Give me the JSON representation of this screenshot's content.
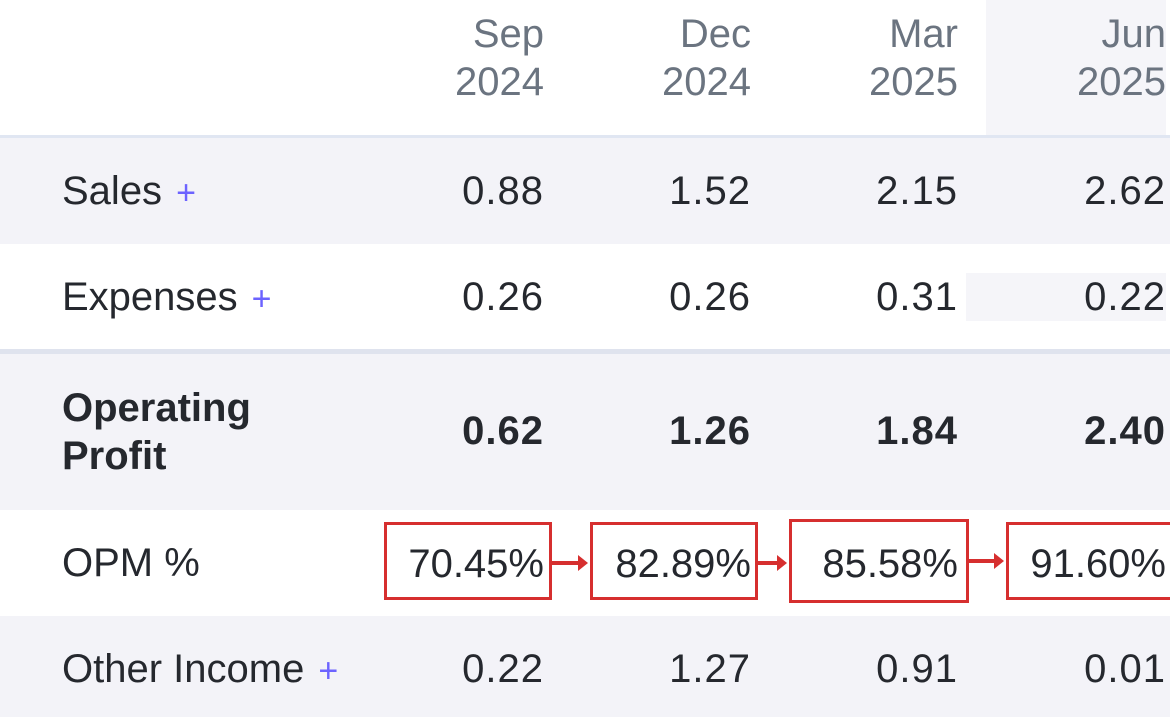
{
  "periods": [
    {
      "month": "Sep",
      "year": "2024"
    },
    {
      "month": "Dec",
      "year": "2024"
    },
    {
      "month": "Mar",
      "year": "2025"
    },
    {
      "month": "Jun",
      "year": "2025"
    }
  ],
  "rows": {
    "sales": {
      "label": "Sales",
      "expand": "+",
      "values": [
        "0.88",
        "1.52",
        "2.15",
        "2.62"
      ]
    },
    "expenses": {
      "label": "Expenses",
      "expand": "+",
      "values": [
        "0.26",
        "0.26",
        "0.31",
        "0.22"
      ]
    },
    "operating_profit": {
      "label_line1": "Operating",
      "label_line2": "Profit",
      "values": [
        "0.62",
        "1.26",
        "1.84",
        "2.40"
      ]
    },
    "opm": {
      "label": "OPM %",
      "values": [
        "70.45%",
        "82.89%",
        "85.58%",
        "91.60%"
      ]
    },
    "other_income": {
      "label": "Other Income",
      "expand": "+",
      "values": [
        "0.22",
        "1.27",
        "0.91",
        "0.01"
      ]
    }
  },
  "colors": {
    "annotation": "#d62f2f",
    "accent": "#6c63ff"
  }
}
